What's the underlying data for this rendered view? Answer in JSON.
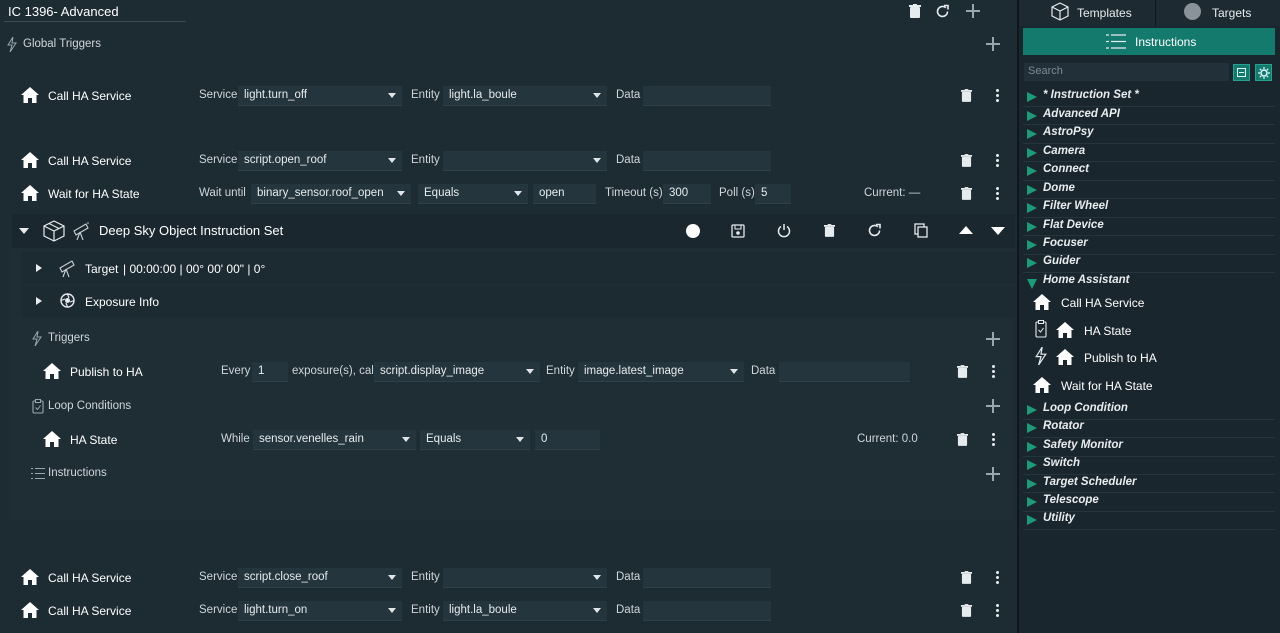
{
  "header": {
    "title": "IC 1396- Advanced"
  },
  "global_triggers": {
    "label": "Global Triggers",
    "rows": [
      {
        "name": "Call HA Service",
        "service_label": "Service",
        "service_value": "light.turn_off",
        "entity_label": "Entity",
        "entity_value": "light.la_boule",
        "data_label": "Data",
        "data_value": ""
      }
    ]
  },
  "rows_top": [
    {
      "name": "Call HA Service",
      "service_label": "Service",
      "service_value": "script.open_roof",
      "entity_label": "Entity",
      "entity_value": "",
      "data_label": "Data",
      "data_value": ""
    }
  ],
  "wait_row": {
    "name": "Wait for HA State",
    "wait_until_label": "Wait until",
    "wait_until_value": "binary_sensor.roof_open",
    "operator_value": "Equals",
    "state_value": "open",
    "timeout_label": "Timeout (s)",
    "timeout_value": "300",
    "poll_label": "Poll (s)",
    "poll_value": "5",
    "current_label": "Current: —"
  },
  "dso": {
    "title": "Deep Sky Object Instruction Set",
    "target_label": "Target",
    "target_info": "| 00:00:00 | 00° 00' 00\" | 0°",
    "exposure_label": "Exposure Info",
    "triggers_label": "Triggers",
    "publish_row": {
      "name": "Publish to HA",
      "every_label": "Every",
      "every_value": "1",
      "call_label": "exposure(s), call",
      "call_value": "script.display_image",
      "entity_label": "Entity",
      "entity_value": "image.latest_image",
      "data_label": "Data",
      "data_value": ""
    },
    "loop_label": "Loop Conditions",
    "ha_state_row": {
      "name": "HA State",
      "while_label": "While",
      "while_value": "sensor.venelles_rain",
      "operator_value": "Equals",
      "value": "0",
      "current_label": "Current: 0.0"
    },
    "instructions_label": "Instructions"
  },
  "rows_bottom": [
    {
      "name": "Call HA Service",
      "service_label": "Service",
      "service_value": "script.close_roof",
      "entity_label": "Entity",
      "entity_value": "",
      "data_label": "Data",
      "data_value": ""
    },
    {
      "name": "Call HA Service",
      "service_label": "Service",
      "service_value": "light.turn_on",
      "entity_label": "Entity",
      "entity_value": "light.la_boule",
      "data_label": "Data",
      "data_value": ""
    }
  ],
  "sidebar": {
    "tabs": [
      "Templates",
      "Targets"
    ],
    "instructions_tab": "Instructions",
    "search_placeholder": "Search",
    "categories_top": [
      "* Instruction Set *",
      "Advanced API",
      "AstroPsy",
      "Camera",
      "Connect",
      "Dome",
      "Filter Wheel",
      "Flat Device",
      "Focuser",
      "Guider"
    ],
    "expanded_category": "Home Assistant",
    "ha_items": [
      "Call HA Service",
      "HA State",
      "Publish to HA",
      "Wait for HA State"
    ],
    "categories_bottom": [
      "Loop Condition",
      "Rotator",
      "Safety Monitor",
      "Switch",
      "Target Scheduler",
      "Telescope",
      "Utility"
    ]
  },
  "colors": {
    "background": "#1d2b33",
    "accent": "#157a6e",
    "category_arrow": "#1e9a7a"
  }
}
